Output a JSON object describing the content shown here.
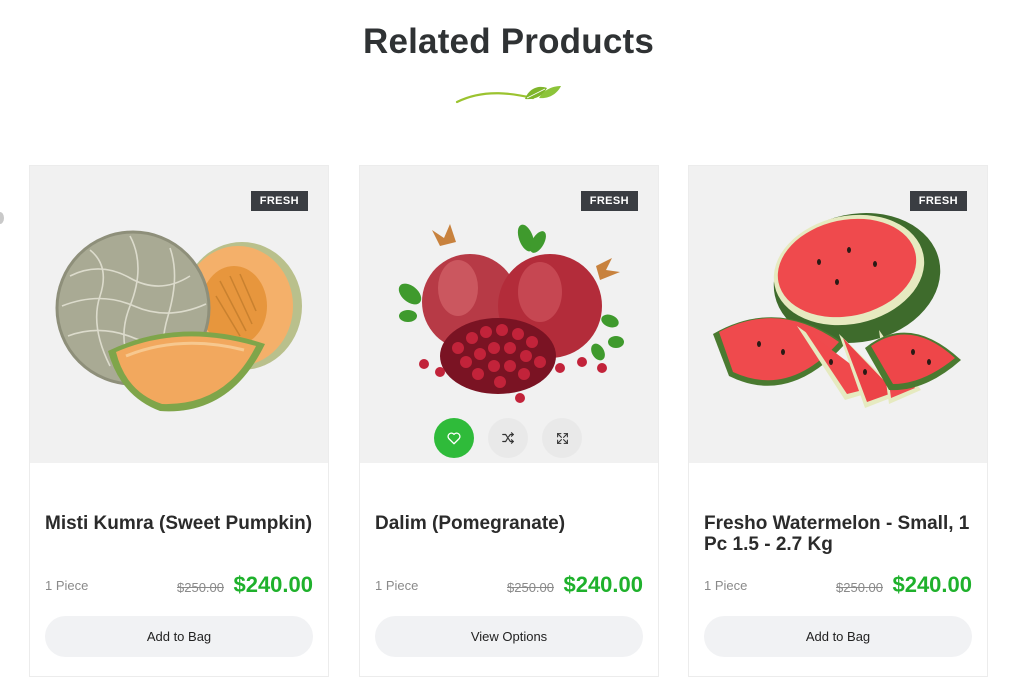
{
  "section": {
    "title": "Related Products"
  },
  "products": [
    {
      "badge": "FRESH",
      "name": "Misti Kumra (Sweet Pumpkin)",
      "unit": "1 Piece",
      "old_price": "$250.00",
      "price": "$240.00",
      "button_label": "Add to Bag",
      "image_icon": "cantaloupe-image"
    },
    {
      "badge": "FRESH",
      "name": "Dalim (Pomegranate)",
      "unit": "1 Piece",
      "old_price": "$250.00",
      "price": "$240.00",
      "button_label": "View Options",
      "image_icon": "pomegranate-image",
      "hover_actions": [
        "heart-icon",
        "shuffle-icon",
        "expand-icon"
      ]
    },
    {
      "badge": "FRESH",
      "name": "Fresho Watermelon - Small, 1 Pc 1.5 - 2.7 Kg",
      "unit": "1 Piece",
      "old_price": "$250.00",
      "price": "$240.00",
      "button_label": "Add to Bag",
      "image_icon": "watermelon-image"
    }
  ],
  "colors": {
    "accent_green": "#2fbb3a",
    "price_green": "#1fb12c",
    "badge_bg": "#3a3d42",
    "media_bg": "#f1f1f1"
  }
}
